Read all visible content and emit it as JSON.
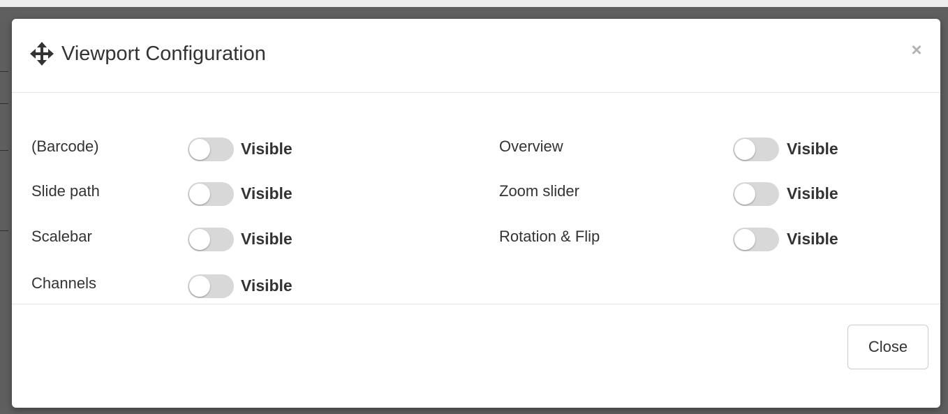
{
  "modal": {
    "title": "Viewport Configuration",
    "icon": "move-icon",
    "close_glyph": "×"
  },
  "options": {
    "left": [
      {
        "label": "(Barcode)",
        "state": "Visible",
        "enabled": false
      },
      {
        "label": "Slide path",
        "state": "Visible",
        "enabled": false
      },
      {
        "label": "Scalebar",
        "state": "Visible",
        "enabled": false
      },
      {
        "label": "Channels",
        "state": "Visible",
        "enabled": false
      }
    ],
    "right": [
      {
        "label": "Overview",
        "state": "Visible",
        "enabled": false
      },
      {
        "label": "Zoom slider",
        "state": "Visible",
        "enabled": false
      },
      {
        "label": "Rotation & Flip",
        "state": "Visible",
        "enabled": false
      }
    ]
  },
  "footer": {
    "close_label": "Close"
  },
  "colors": {
    "backdrop": "#5f5f5f",
    "switch_off": "#d8d8d8",
    "text": "#333333"
  }
}
